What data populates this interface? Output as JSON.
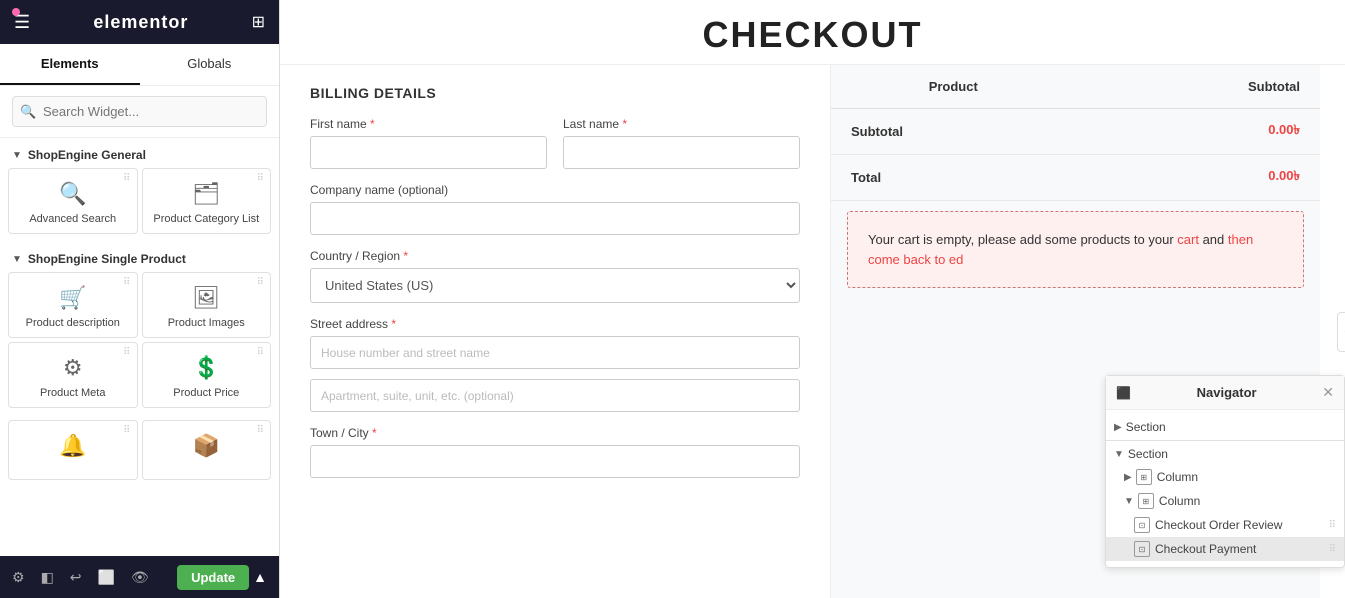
{
  "sidebar": {
    "brand": "elementor",
    "tabs": [
      {
        "label": "Elements",
        "active": true
      },
      {
        "label": "Globals",
        "active": false
      }
    ],
    "search_placeholder": "Search Widget...",
    "sections": [
      {
        "label": "ShopEngine General",
        "widgets": [
          {
            "name": "Advanced Search",
            "icon": "🔍"
          },
          {
            "name": "Product Category List",
            "icon": "🗂"
          }
        ]
      },
      {
        "label": "ShopEngine Single Product",
        "widgets": [
          {
            "name": "Product description",
            "icon": "🛒"
          },
          {
            "name": "Product Images",
            "icon": "🖼"
          },
          {
            "name": "Product Meta",
            "icon": "⚙"
          },
          {
            "name": "Product Price",
            "icon": "💲"
          }
        ]
      }
    ],
    "toolbar": {
      "update_label": "Update"
    }
  },
  "main": {
    "title": "CHECKOUT",
    "billing": {
      "section_title": "BILLING DETAILS",
      "first_name_label": "First name",
      "first_name_required": "*",
      "last_name_label": "Last name",
      "last_name_required": "*",
      "company_label": "Company name (optional)",
      "country_label": "Country / Region",
      "country_required": "*",
      "country_value": "United States (US)",
      "street_label": "Street address",
      "street_required": "*",
      "street_placeholder": "House number and street name",
      "street2_placeholder": "Apartment, suite, unit, etc. (optional)",
      "city_label": "Town / City",
      "city_required": "*"
    },
    "order_review": {
      "col_product": "Product",
      "col_subtotal": "Subtotal",
      "subtotal_label": "Subtotal",
      "subtotal_value": "0.00৳",
      "total_label": "Total",
      "total_value": "0.00৳",
      "empty_cart_text": "Your cart is empty, please add some products to your cart and then come back to ed"
    }
  },
  "navigator": {
    "title": "Navigator",
    "items": [
      {
        "label": "Section",
        "level": 0,
        "type": "section",
        "expanded": false
      },
      {
        "label": "Section",
        "level": 0,
        "type": "section",
        "expanded": true
      },
      {
        "label": "Column",
        "level": 1,
        "type": "column",
        "expanded": false
      },
      {
        "label": "Column",
        "level": 1,
        "type": "column",
        "expanded": true
      },
      {
        "label": "Checkout Order Review",
        "level": 2,
        "type": "widget"
      },
      {
        "label": "Checkout Payment",
        "level": 2,
        "type": "widget",
        "active": true
      }
    ]
  }
}
